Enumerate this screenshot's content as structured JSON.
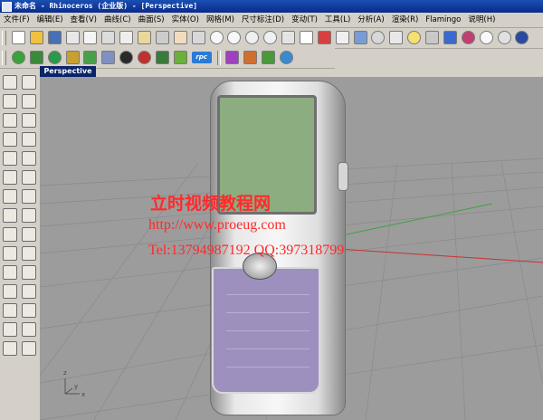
{
  "window": {
    "title": "未命名 - Rhinoceros (企业版) - [Perspective]"
  },
  "menu": [
    "文件(F)",
    "编辑(E)",
    "查看(V)",
    "曲线(C)",
    "曲面(S)",
    "实体(O)",
    "网格(M)",
    "尺寸标注(D)",
    "变动(T)",
    "工具(L)",
    "分析(A)",
    "渲染(R)",
    "Flamingo",
    "说明(H)"
  ],
  "toolbar": {
    "rpc_label": "rpc"
  },
  "viewport": {
    "tab_label": "Perspective",
    "axis_z": "z",
    "axis_y": "y",
    "axis_x": "x"
  },
  "watermark": {
    "title": "立时视频教程网",
    "url": "http://www.proeug.com",
    "contact": "Tel:13794987192  QQ:397318799"
  },
  "colors": {
    "title_bar": "#0a2a8a",
    "viewport_bg": "#9c9c9c",
    "grid_line": "#8a8a8a",
    "x_axis": "#c83232",
    "y_axis": "#3fa23f",
    "phone_screen": "#8cad80",
    "phone_keypad": "#9d90bf",
    "watermark_text": "#ff2a2a"
  }
}
